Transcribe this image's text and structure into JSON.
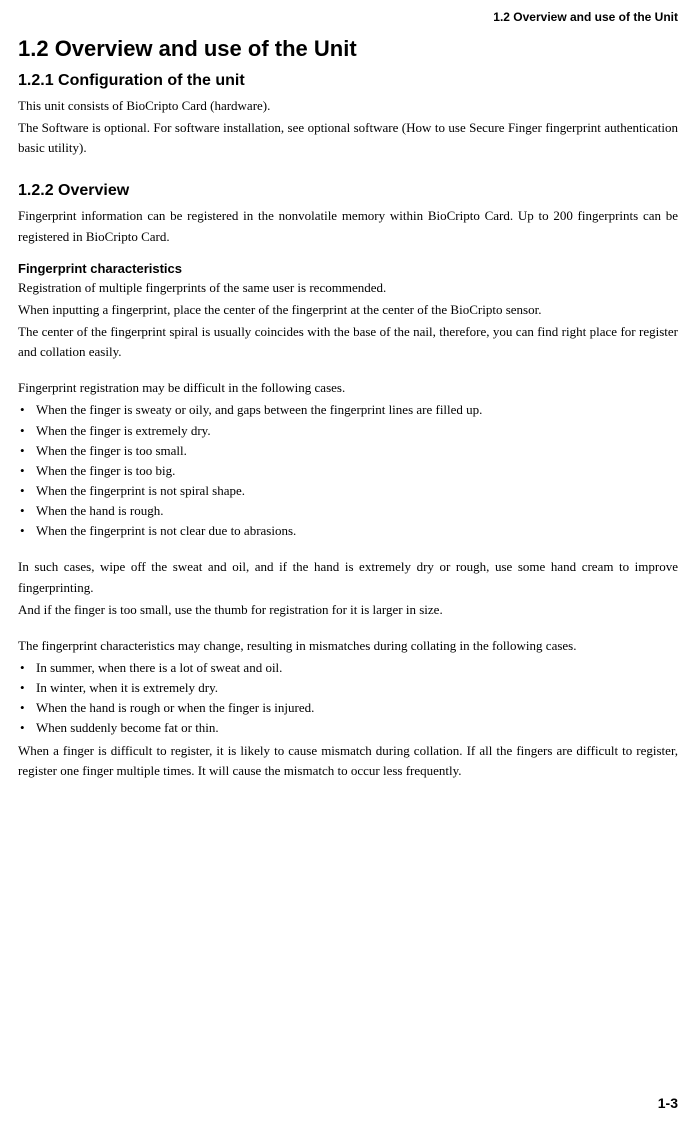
{
  "running_head": "1.2  Overview and use of the Unit",
  "h1": "1.2  Overview and use of the Unit",
  "s121": {
    "title": "1.2.1  Configuration of the unit",
    "p1": "This unit consists of BioCripto Card (hardware).",
    "p2": "The Software is optional.  For software installation, see optional software (How to use Secure Finger fingerprint authentication basic utility)."
  },
  "s122": {
    "title": "1.2.2  Overview",
    "p1": "Fingerprint information can be registered in the nonvolatile memory within BioCripto Card.  Up to 200 fingerprints can be registered in BioCripto Card.",
    "fc_title": "Fingerprint characteristics",
    "fc_p1": "Registration of multiple fingerprints of the same user is recommended.",
    "fc_p2": "When inputting a fingerprint, place the center of the fingerprint at the center of the BioCripto sensor.",
    "fc_p3": "The center of the fingerprint spiral is usually coincides with the base of the nail, therefore, you can find right place for register and collation easily.",
    "diff_intro": "Fingerprint registration may be difficult in the following cases.",
    "diff_items": [
      "When the finger is sweaty or oily, and gaps between the fingerprint lines are filled up.",
      "When the finger is extremely dry.",
      "When the finger is too small.",
      "When the finger is too big.",
      "When the fingerprint is not spiral shape.",
      "When the hand is rough.",
      "When the fingerprint is not clear due to abrasions."
    ],
    "remedy_p1": "In such cases, wipe off the sweat and oil, and if the hand is extremely dry or rough, use some hand cream to improve fingerprinting.",
    "remedy_p2": "And if the finger is too small, use the thumb for registration for it is larger in size.",
    "change_intro": "The fingerprint characteristics may change, resulting in mismatches during collating in the following cases.",
    "change_items": [
      "In summer, when there is a lot of sweat and oil.",
      "In winter, when it is extremely dry.",
      "When the hand is rough or when the finger is injured.",
      "When suddenly become fat or thin."
    ],
    "closing": "When a finger is difficult to register, it is likely to cause mismatch during collation.  If all the fingers are difficult to register, register one finger multiple times.  It will cause the mismatch to occur less frequently."
  },
  "page_num": "1-3"
}
